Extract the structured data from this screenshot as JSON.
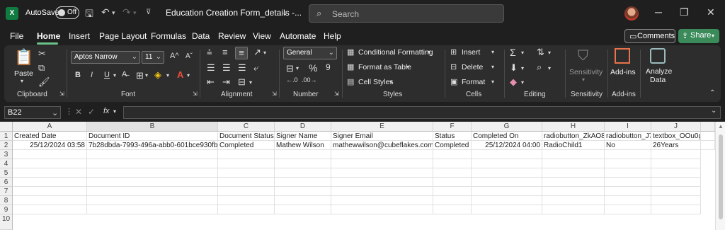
{
  "titlebar": {
    "logo": "X",
    "autosave_label": "AutoSave",
    "autosave_state": "Off",
    "doc_title": "Education Creation Form_details -...",
    "search_placeholder": "Search"
  },
  "menu": [
    "File",
    "Home",
    "Insert",
    "Page Layout",
    "Formulas",
    "Data",
    "Review",
    "View",
    "Automate",
    "Help"
  ],
  "active_menu": "Home",
  "buttons": {
    "comments": "Comments",
    "share": "Share"
  },
  "ribbon": {
    "clipboard": {
      "paste": "Paste",
      "label": "Clipboard"
    },
    "font": {
      "name": "Aptos Narrow",
      "size": "11",
      "label": "Font"
    },
    "alignment": {
      "label": "Alignment"
    },
    "number": {
      "format": "General",
      "label": "Number"
    },
    "styles": {
      "conditional": "Conditional Formatting",
      "table": "Format as Table",
      "cell": "Cell Styles",
      "label": "Styles"
    },
    "cells": {
      "insert": "Insert",
      "delete": "Delete",
      "format": "Format",
      "label": "Cells"
    },
    "editing": {
      "label": "Editing"
    },
    "sensitivity": {
      "btn": "Sensitivity",
      "label": "Sensitivity"
    },
    "addins": {
      "btn": "Add-ins",
      "label": "Add-ins"
    },
    "analyze": {
      "line1": "Analyze",
      "line2": "Data"
    }
  },
  "formula": {
    "namebox": "B22",
    "fx": "fx",
    "value": ""
  },
  "columns": [
    "A",
    "B",
    "C",
    "D",
    "E",
    "F",
    "G",
    "H",
    "I",
    "J"
  ],
  "rows": [
    [
      "Created Date",
      "Document ID",
      "Document Status",
      "Signer Name",
      "Signer Email",
      "Status",
      "Completed On",
      "radiobutton_ZkAO8",
      "radiobutton_J7c",
      "textbox_OOu0g"
    ],
    [
      "25/12/2024 03:58",
      "7b28dbda-7993-496a-abb0-601bce930fb4",
      "Completed",
      "Mathew Wilson",
      "mathewwilson@cubeflakes.com",
      "Completed",
      "25/12/2024 04:00",
      "RadioChild1",
      "No",
      "26Years"
    ]
  ],
  "row_numbers": [
    "1",
    "2",
    "3",
    "4",
    "5",
    "6",
    "7",
    "8",
    "9",
    "10"
  ],
  "colors": {
    "excel_green": "#107c41",
    "share_green": "#3a8a5a",
    "tab_underline": "#6cc48b"
  }
}
